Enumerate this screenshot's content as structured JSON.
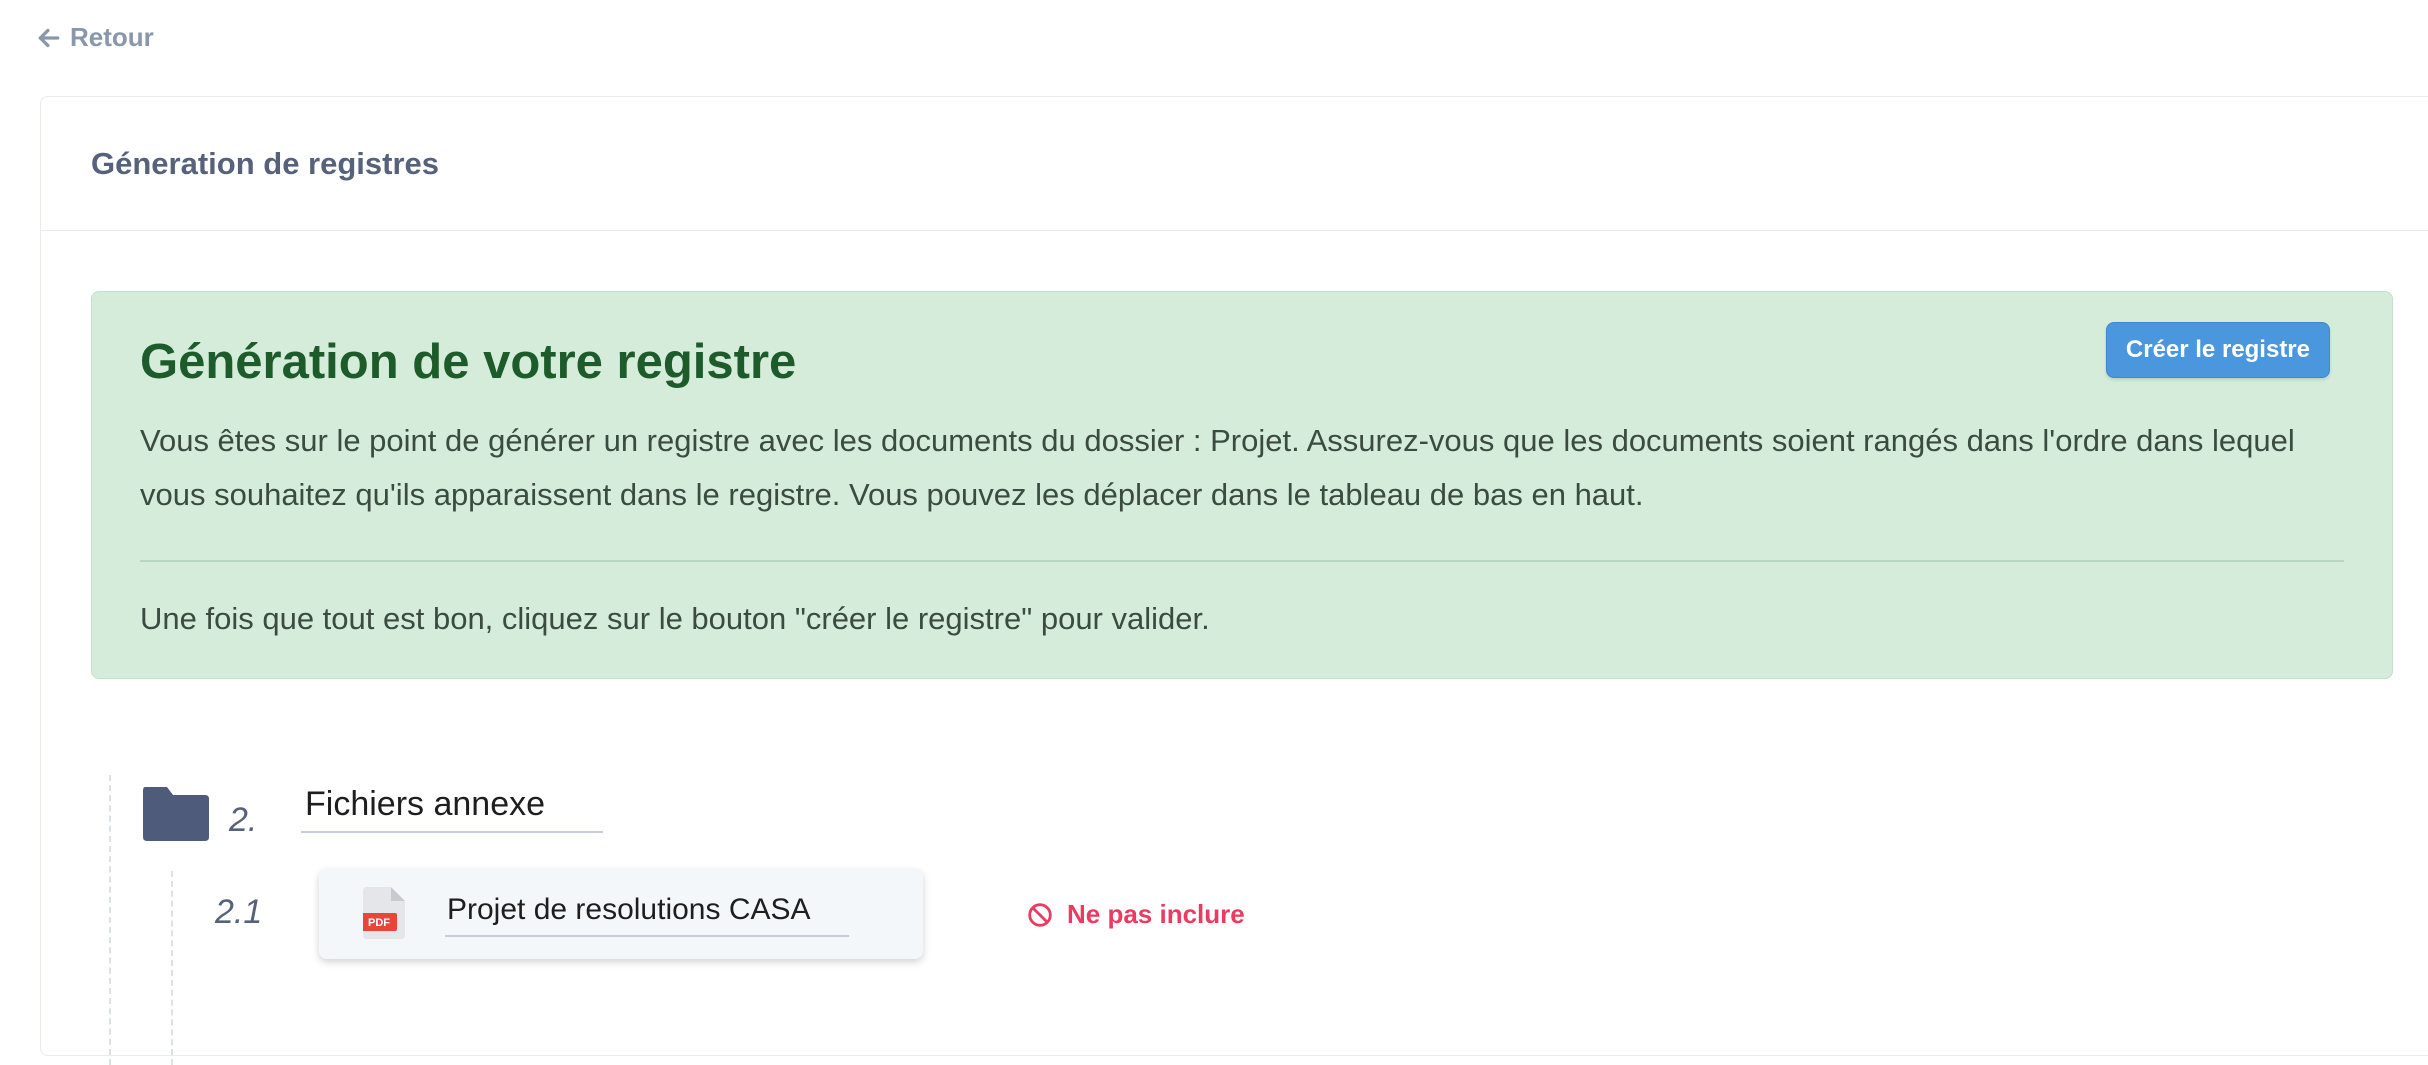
{
  "nav": {
    "back_label": "Retour"
  },
  "card": {
    "title": "Géneration de registres"
  },
  "alert": {
    "heading": "Génération de votre registre",
    "create_button": "Créer le registre",
    "paragraph": "Vous êtes sur le point de générer un registre avec les documents du dossier : Projet. Assurez-vous que les documents soient rangés dans l'ordre dans lequel vous souhaitez qu'ils apparaissent dans le registre. Vous pouvez les déplacer dans le tableau de bas en haut.",
    "instruction": "Une fois que tout est bon, cliquez sur le bouton \"créer le registre\" pour valider."
  },
  "tree": {
    "folder": {
      "number": "2.",
      "name": "Fichiers annexe",
      "icon": "folder-icon"
    },
    "documents": [
      {
        "number": "2.1",
        "name": "Projet de resolutions CASA",
        "icon": "pdf-file-icon",
        "pdf_label": "PDF",
        "exclude_label": "Ne pas inclure"
      }
    ]
  },
  "colors": {
    "alert_bg": "#d5ecdb",
    "heading_green": "#1d5b2b",
    "button_blue": "#4a97de",
    "exclude_red": "#ec3b62",
    "slate": "#56627c"
  }
}
